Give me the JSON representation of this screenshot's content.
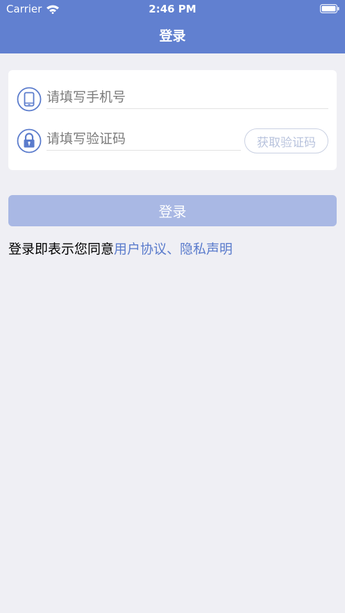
{
  "status_bar": {
    "carrier": "Carrier",
    "time": "2:46 PM"
  },
  "nav": {
    "title": "登录"
  },
  "form": {
    "phone": {
      "placeholder": "请填写手机号",
      "value": ""
    },
    "code": {
      "placeholder": "请填写验证码",
      "value": ""
    },
    "get_code_label": "获取验证码"
  },
  "login_button_label": "登录",
  "agreement": {
    "prefix": "登录即表示您同意",
    "user_agreement": "用户协议",
    "separator": "、",
    "privacy": "隐私声明"
  },
  "colors": {
    "header": "#6180d0",
    "accent": "#5a7bcc",
    "login_button_disabled": "#a9b8e4",
    "background": "#efeff4"
  },
  "icons": {
    "phone_field": "phone-icon",
    "code_field": "lock-icon",
    "wifi": "wifi-icon",
    "battery": "battery-icon"
  }
}
